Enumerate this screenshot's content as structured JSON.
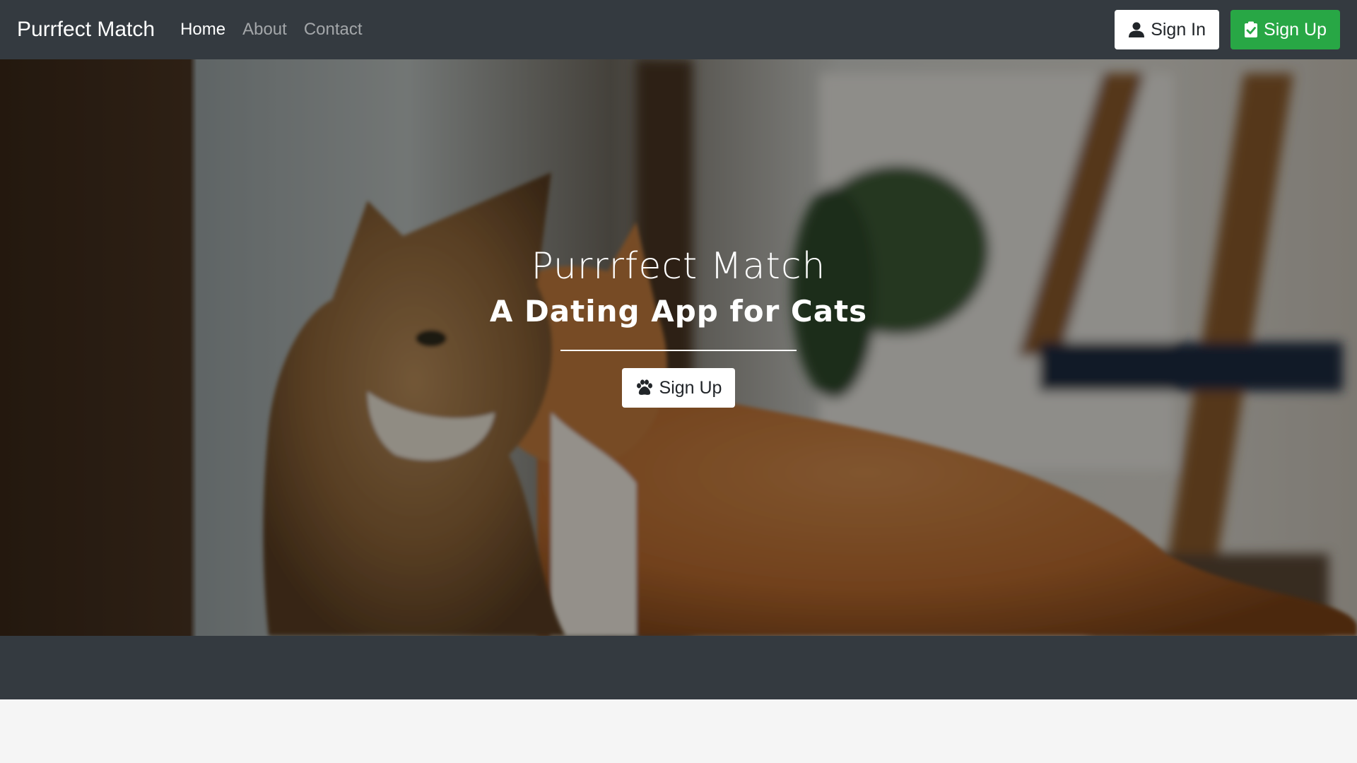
{
  "navbar": {
    "brand": "Purrfect Match",
    "links": [
      {
        "label": "Home",
        "active": true
      },
      {
        "label": "About",
        "active": false
      },
      {
        "label": "Contact",
        "active": false
      }
    ],
    "sign_in_label": "Sign In",
    "sign_up_label": "Sign Up"
  },
  "hero": {
    "title": "Purrrfect Match",
    "subtitle": "A Dating App for Cats",
    "cta_label": "Sign Up"
  },
  "icons": {
    "sign_in": "user-icon",
    "sign_up": "clipboard-check-icon",
    "cta": "paw-icon"
  },
  "colors": {
    "navbar_bg": "#343a40",
    "success": "#28a745",
    "light": "#ffffff",
    "page_bg": "#f5f5f5"
  }
}
